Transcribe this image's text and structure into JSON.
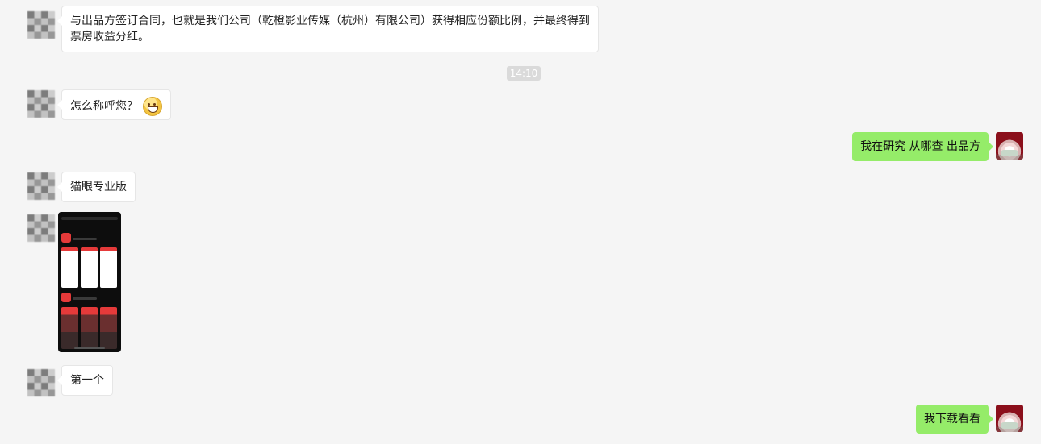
{
  "chat": {
    "time_divider": "14:10",
    "messages": [
      {
        "side": "left",
        "text": "与出品方签订合同，也就是我们公司（乾橙影业传媒（杭州）有限公司）获得相应份额比例，并最终得到票房收益分红。"
      },
      {
        "side": "left",
        "text": "怎么称呼您？",
        "emoji": "grin-emoji"
      },
      {
        "side": "right",
        "text": "我在研究 从哪查 出品方"
      },
      {
        "side": "left",
        "text": "猫眼专业版"
      },
      {
        "side": "left",
        "type": "image"
      },
      {
        "side": "left",
        "text": "第一个"
      },
      {
        "side": "right",
        "text": "我下载看看"
      }
    ]
  },
  "colors": {
    "background": "#f5f5f5",
    "bubble_left": "#ffffff",
    "bubble_right": "#95ec69",
    "accent_red": "#e53a3a"
  }
}
